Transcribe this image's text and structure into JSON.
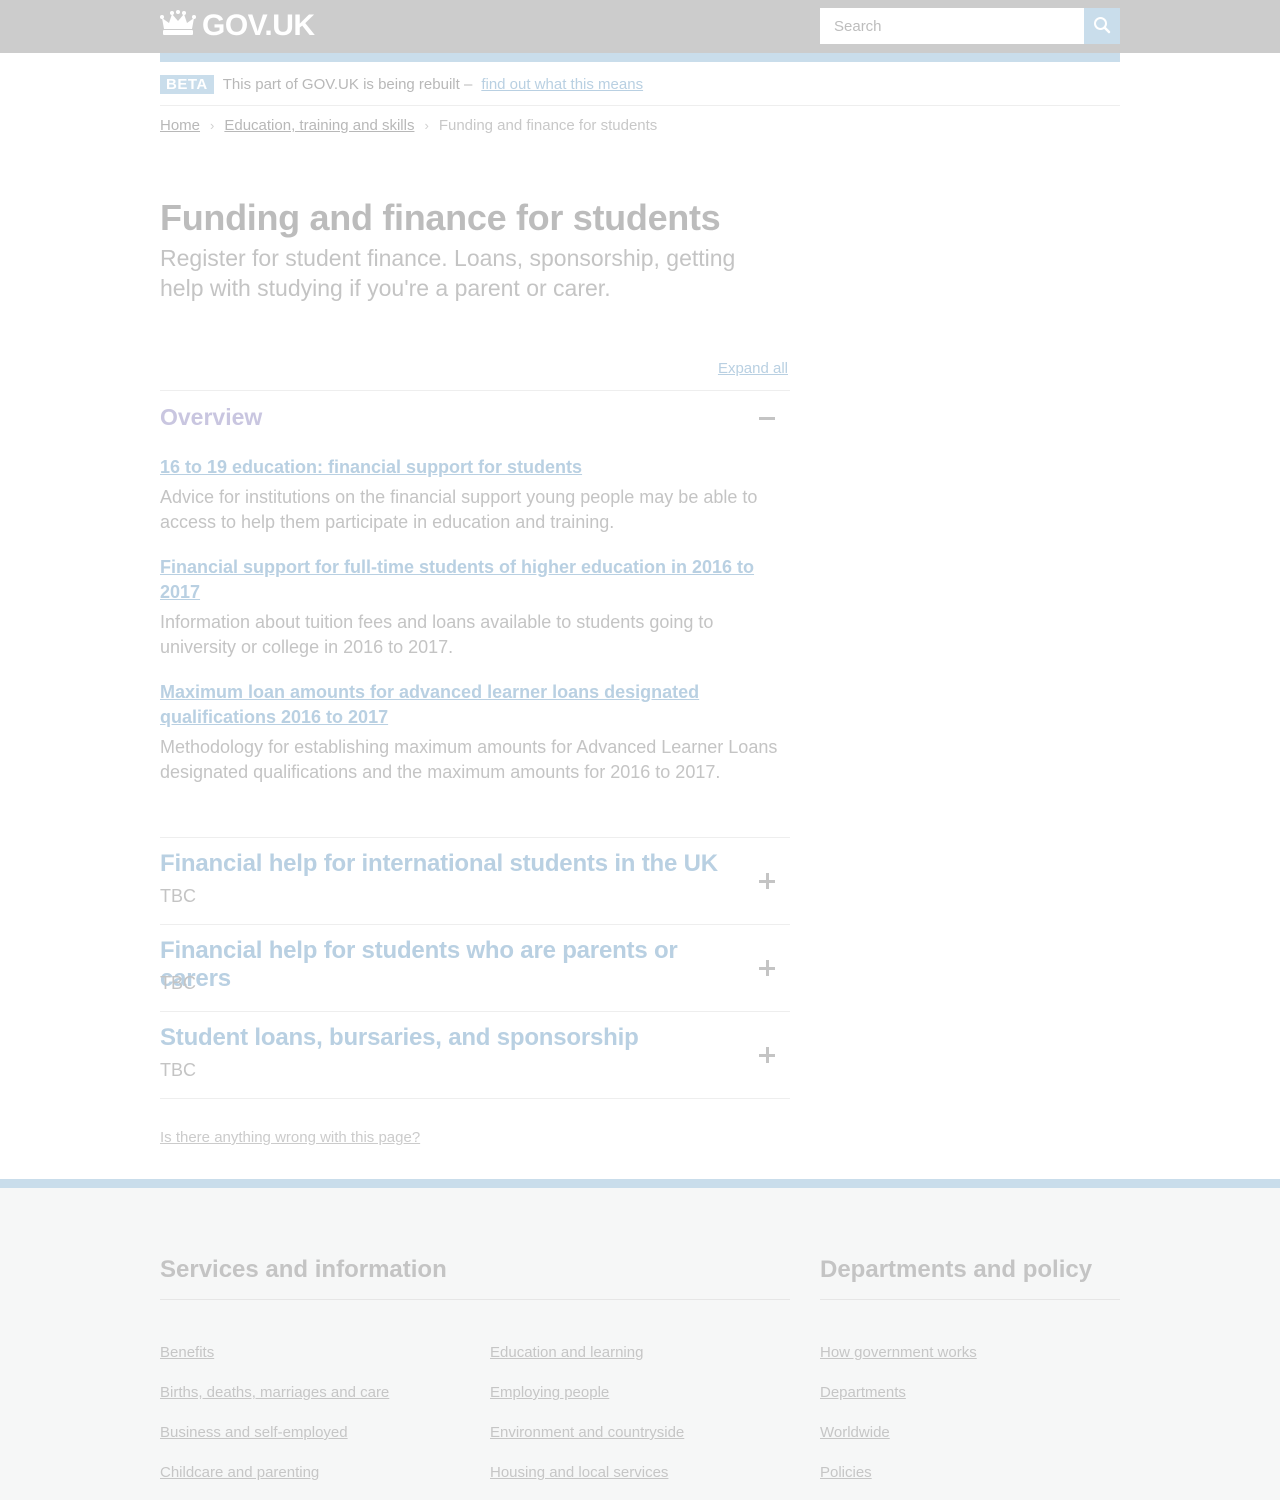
{
  "header": {
    "logo_text": "GOV.UK",
    "search_placeholder": "Search"
  },
  "beta": {
    "tag": "BETA",
    "text": "This part of GOV.UK is being rebuilt –",
    "link": "find out what this means"
  },
  "breadcrumb": {
    "items": [
      "Home",
      "Education, training and skills"
    ],
    "current": "Funding and finance for students"
  },
  "page": {
    "title": "Funding and finance for students",
    "description": "Register for student finance. Loans, sponsorship, getting help with studying if you're a parent or carer.",
    "expand_all": "Expand all"
  },
  "overview": {
    "title": "Overview",
    "items": [
      {
        "link": "16 to 19 education: financial support for students",
        "description": "Advice for institutions on the financial support young people may be able to access to help them participate in education and training."
      },
      {
        "link": "Financial support for full-time students of higher education in 2016 to 2017",
        "description": "Information about tuition fees and loans available to students going to university or college in 2016 to 2017."
      },
      {
        "link": "Maximum loan amounts for advanced learner loans designated qualifications 2016 to 2017",
        "description": "Methodology for establishing maximum amounts for Advanced Learner Loans designated qualifications and the maximum amounts for 2016 to 2017."
      }
    ]
  },
  "sections": [
    {
      "title": "Financial help for international students in the UK",
      "subtitle": "TBC"
    },
    {
      "title": "Financial help for students who are parents or carers",
      "subtitle": "TBC"
    },
    {
      "title": "Student loans, bursaries, and sponsorship",
      "subtitle": "TBC"
    }
  ],
  "report_link": "Is there anything wrong with this page?",
  "footer": {
    "services_heading": "Services and information",
    "departments_heading": "Departments and policy",
    "services_col1": [
      "Benefits",
      "Births, deaths, marriages and care",
      "Business and self-employed",
      "Childcare and parenting"
    ],
    "services_col2": [
      "Education and learning",
      "Employing people",
      "Environment and countryside",
      "Housing and local services"
    ],
    "departments": [
      "How government works",
      "Departments",
      "Worldwide",
      "Policies"
    ]
  },
  "colors": {
    "header_bg": "#cccccc",
    "accent_blue": "#c9ddeb",
    "link_blue": "#b9d0e2",
    "overview_purple": "#c9c6e0"
  }
}
